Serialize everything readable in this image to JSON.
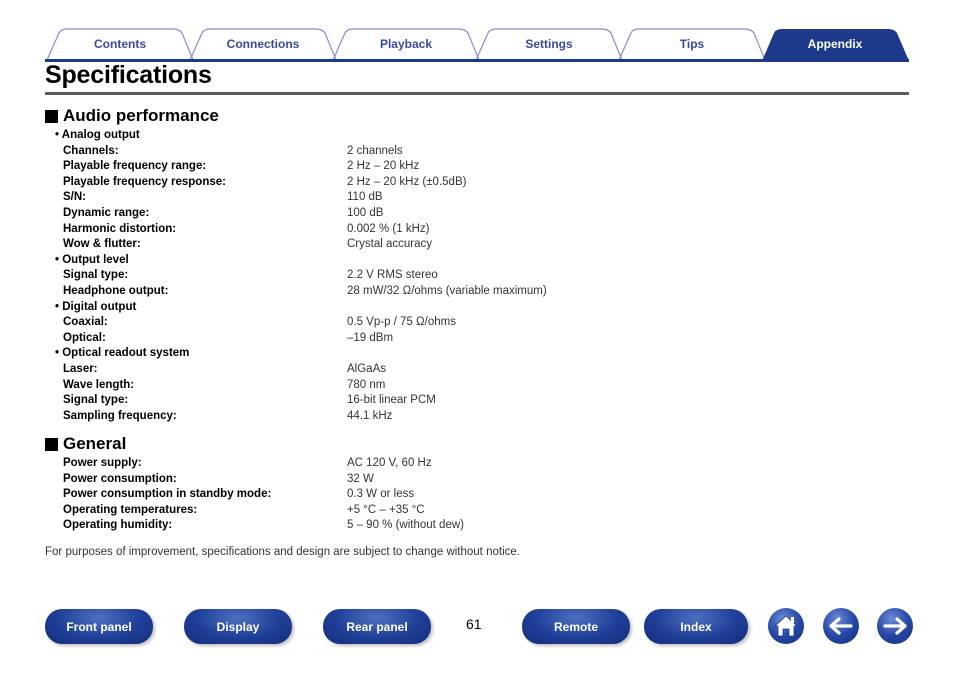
{
  "tabs": [
    {
      "label": "Contents",
      "active": false
    },
    {
      "label": "Connections",
      "active": false
    },
    {
      "label": "Playback",
      "active": false
    },
    {
      "label": "Settings",
      "active": false
    },
    {
      "label": "Tips",
      "active": false
    },
    {
      "label": "Appendix",
      "active": true
    }
  ],
  "colors": {
    "accent": "#1d3a8a",
    "tab_text": "#3a4a9c",
    "tab_border": "#8c8cc4"
  },
  "page_title": "Specifications",
  "sections": [
    {
      "heading": "Audio performance",
      "rows": [
        {
          "type": "sub",
          "label": "• Analog output"
        },
        {
          "label": "Channels:",
          "value": "2 channels"
        },
        {
          "label": "Playable frequency range:",
          "value": "2 Hz – 20 kHz"
        },
        {
          "label": "Playable frequency response:",
          "value": "2 Hz – 20 kHz (±0.5dB)"
        },
        {
          "label": "S/N:",
          "value": "110 dB"
        },
        {
          "label": "Dynamic range:",
          "value": "100 dB"
        },
        {
          "label": "Harmonic distortion:",
          "value": "0.002 % (1 kHz)"
        },
        {
          "label": "Wow & flutter:",
          "value": "Crystal accuracy"
        },
        {
          "type": "sub",
          "label": "• Output level"
        },
        {
          "label": "Signal type:",
          "value": "2.2 V RMS stereo"
        },
        {
          "label": "Headphone output:",
          "value": "28 mW/32 Ω/ohms (variable maximum)"
        },
        {
          "type": "sub",
          "label": "• Digital output"
        },
        {
          "label": "Coaxial:",
          "value": "0.5 Vp-p / 75 Ω/ohms"
        },
        {
          "label": "Optical:",
          "value": "–19 dBm"
        },
        {
          "type": "sub",
          "label": "• Optical readout system"
        },
        {
          "label": "Laser:",
          "value": "AlGaAs"
        },
        {
          "label": "Wave length:",
          "value": "780 nm"
        },
        {
          "label": "Signal type:",
          "value": "16-bit linear PCM"
        },
        {
          "label": "Sampling frequency:",
          "value": "44.1 kHz"
        }
      ]
    },
    {
      "heading": "General",
      "rows": [
        {
          "label": "Power supply:",
          "value": "AC 120 V, 60 Hz"
        },
        {
          "label": "Power consumption:",
          "value": "32 W"
        },
        {
          "label": "Power consumption in standby mode:",
          "value": "0.3 W or less"
        },
        {
          "label": "Operating temperatures:",
          "value": "+5 °C – +35 °C"
        },
        {
          "label": "Operating humidity:",
          "value": "5 – 90 % (without dew)"
        }
      ]
    }
  ],
  "notice": "For purposes of improvement, specifications and design are subject to change without notice.",
  "bottom_nav": {
    "buttons": [
      "Front panel",
      "Display",
      "Rear panel",
      "Remote",
      "Index"
    ],
    "page_number": "61",
    "icons": [
      "home-icon",
      "back-arrow-icon",
      "forward-arrow-icon"
    ]
  }
}
